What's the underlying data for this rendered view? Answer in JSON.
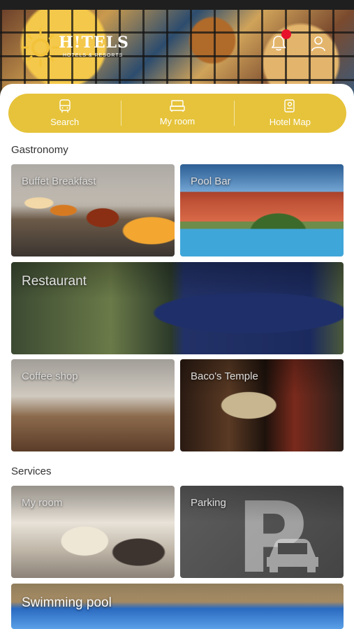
{
  "header": {
    "logo_text": "H!TELS",
    "logo_sub": "HOTELS & RESORTS",
    "notification_count": 1
  },
  "quickbar": [
    {
      "label": "Search",
      "icon": "bus-icon"
    },
    {
      "label": "My room",
      "icon": "bed-icon"
    },
    {
      "label": "Hotel Map",
      "icon": "map-icon"
    }
  ],
  "gastronomy": {
    "title": "Gastronomy",
    "tiles": [
      {
        "label": "Buffet Breakfast"
      },
      {
        "label": "Pool Bar"
      },
      {
        "label": "Restaurant"
      },
      {
        "label": "Coffee shop"
      },
      {
        "label": "Baco's Temple"
      }
    ]
  },
  "services": {
    "title": "Services",
    "tiles": [
      {
        "label": "My room"
      },
      {
        "label": "Parking"
      },
      {
        "label": "Swimming pool"
      }
    ]
  },
  "colors": {
    "accent": "#e6c33a",
    "notification": "#e8102a"
  }
}
